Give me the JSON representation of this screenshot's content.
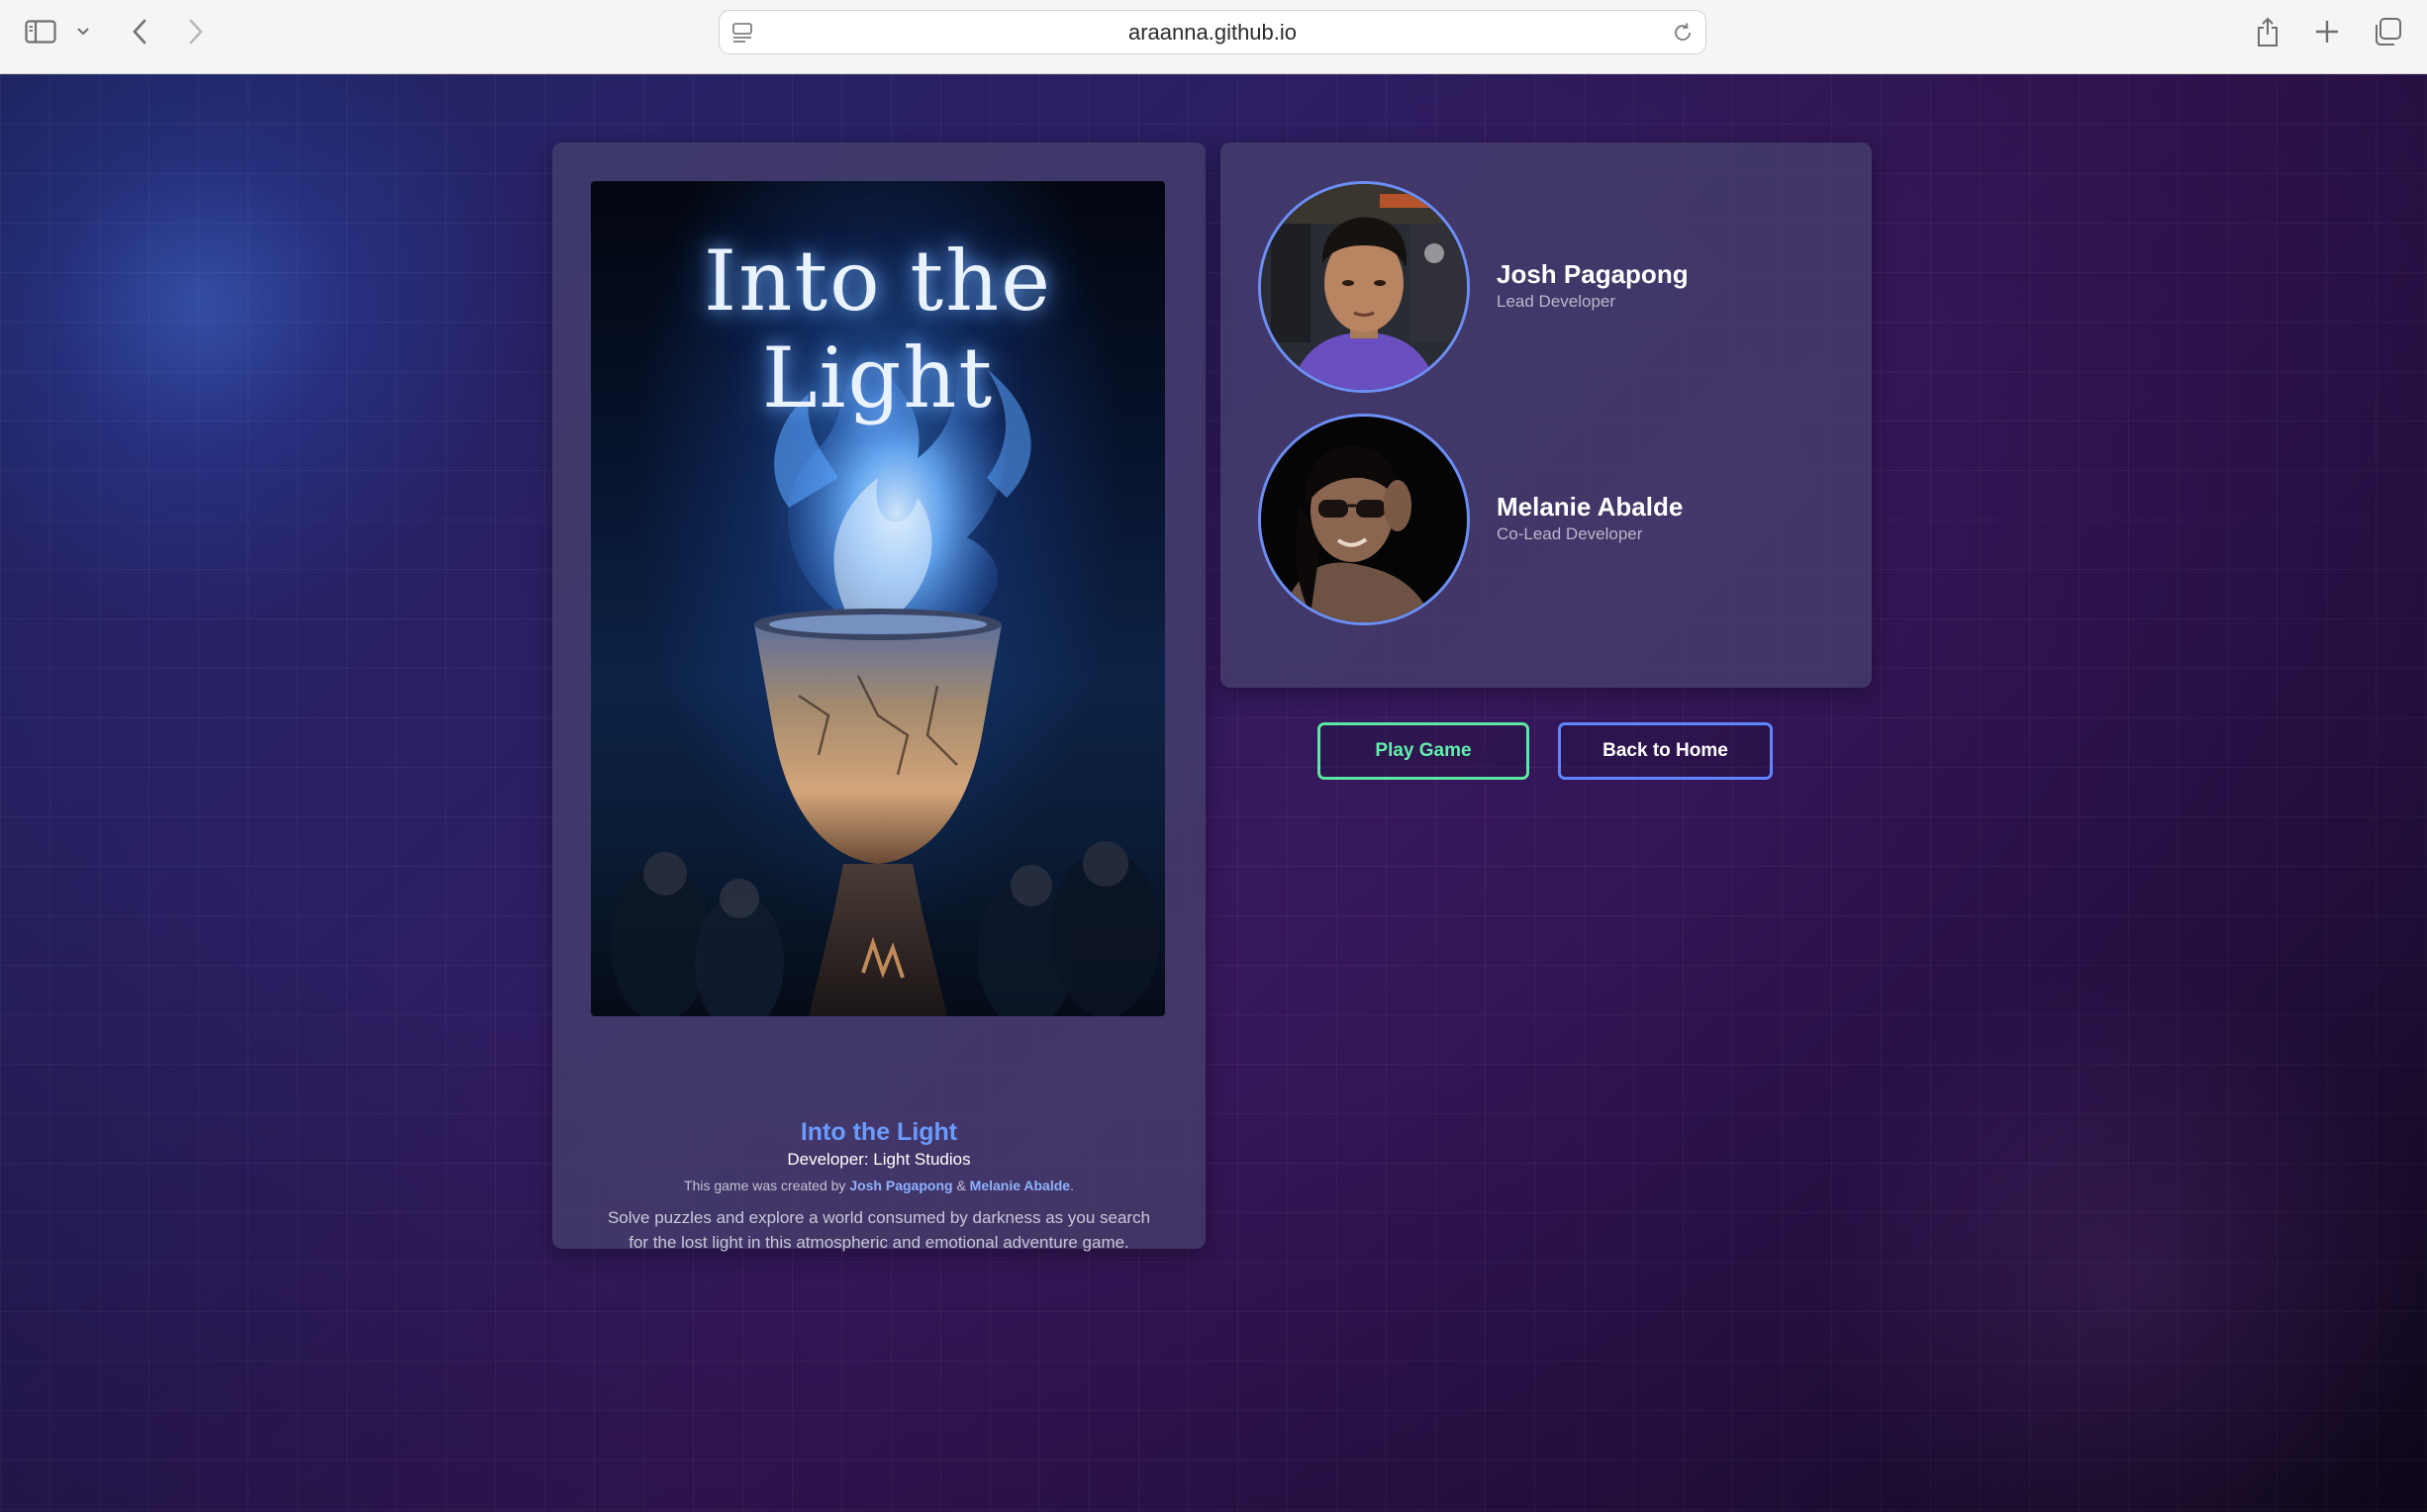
{
  "browser": {
    "url": "araanna.github.io",
    "icons": [
      "sidebar-icon",
      "chevron-down-icon",
      "back-icon",
      "forward-icon",
      "page-menu-icon",
      "reload-icon",
      "share-icon",
      "new-tab-icon",
      "tabs-overview-icon"
    ]
  },
  "game": {
    "poster_title": "Into the Light",
    "title": "Into the Light",
    "developer": "Developer: Light Studios",
    "credits_prefix": "This game was created by",
    "credit_author_1": "Josh Pagapong",
    "credits_and": "&",
    "credit_author_2": "Melanie Abalde",
    "credits_suffix": ".",
    "description": "Solve puzzles and explore a world consumed by darkness as you search for the lost light in this atmospheric and emotional adventure game."
  },
  "team": {
    "members": [
      {
        "name": "Josh Pagapong",
        "role": "Lead Developer"
      },
      {
        "name": "Melanie Abalde",
        "role": "Co-Lead Developer"
      }
    ]
  },
  "actions": {
    "play_label": "Play Game",
    "home_label": "Back to Home"
  },
  "colors": {
    "accent_blue": "#6b9bff",
    "play_green": "#5be8a2",
    "home_blue": "#5f86ff"
  }
}
